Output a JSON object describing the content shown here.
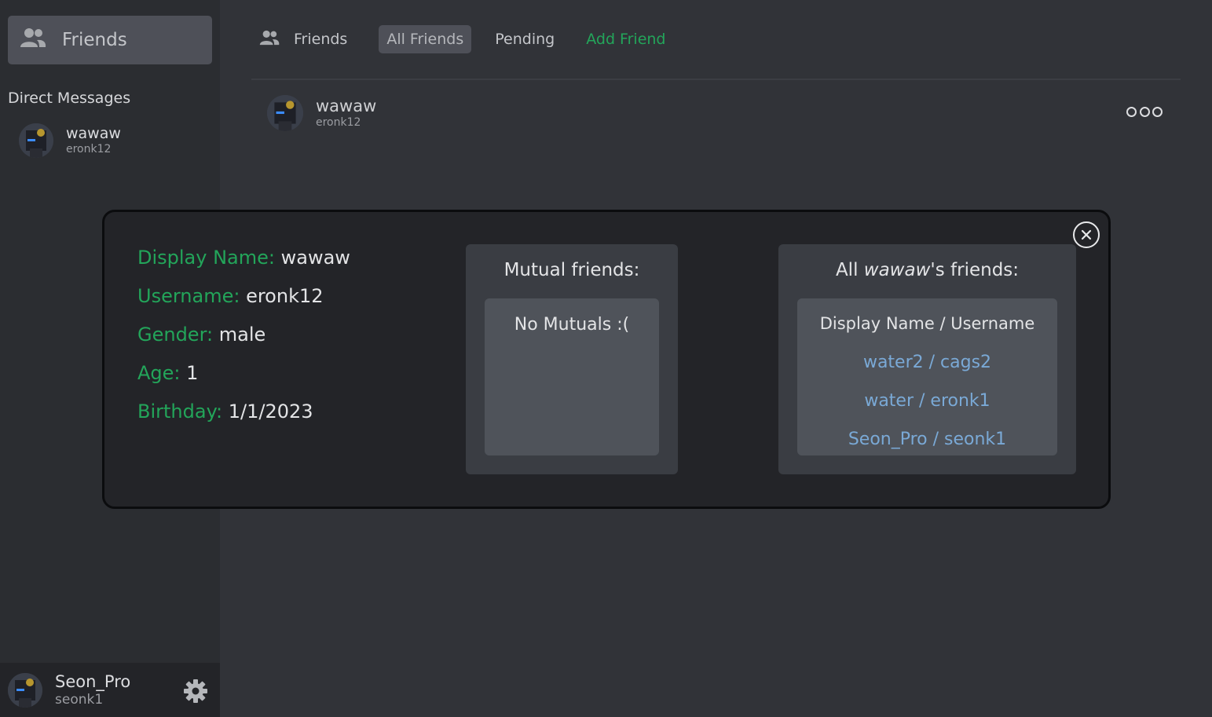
{
  "sidebar": {
    "friends_button": "Friends",
    "direct_messages_heading": "Direct Messages",
    "dm_items": [
      {
        "display_name": "wawaw",
        "username": "eronk12"
      }
    ],
    "current_user": {
      "display_name": "Seon_Pro",
      "username": "seonk1"
    }
  },
  "topbar": {
    "title": "Friends",
    "tabs": [
      {
        "label": "All Friends",
        "active": true
      },
      {
        "label": "Pending",
        "active": false
      },
      {
        "label": "Add Friend",
        "active": false
      }
    ]
  },
  "friend_list": [
    {
      "display_name": "wawaw",
      "username": "eronk12"
    }
  ],
  "profile_modal": {
    "fields": [
      {
        "label": "Display Name:",
        "value": "wawaw"
      },
      {
        "label": "Username:",
        "value": "eronk12"
      },
      {
        "label": "Gender:",
        "value": "male"
      },
      {
        "label": "Age:",
        "value": "1"
      },
      {
        "label": "Birthday:",
        "value": "1/1/2023"
      }
    ],
    "mutual_title": "Mutual friends:",
    "mutual_empty": "No Mutuals :(",
    "all_friends_prefix": "All ",
    "all_friends_name": "wawaw",
    "all_friends_suffix": "'s friends:",
    "all_friends_header": "Display Name / Username",
    "all_friends": [
      "water2 / cags2",
      "water / eronk1",
      "Seon_Pro / seonk1"
    ]
  },
  "colors": {
    "accent_green": "#23a55a",
    "link_blue": "#7aa9d6",
    "background": "#313338",
    "sidebar": "#2b2d31",
    "modal": "#232428"
  },
  "icons": {
    "friends": "people-icon",
    "settings": "gear-icon",
    "close": "close-icon",
    "more": "more-options-icon"
  }
}
